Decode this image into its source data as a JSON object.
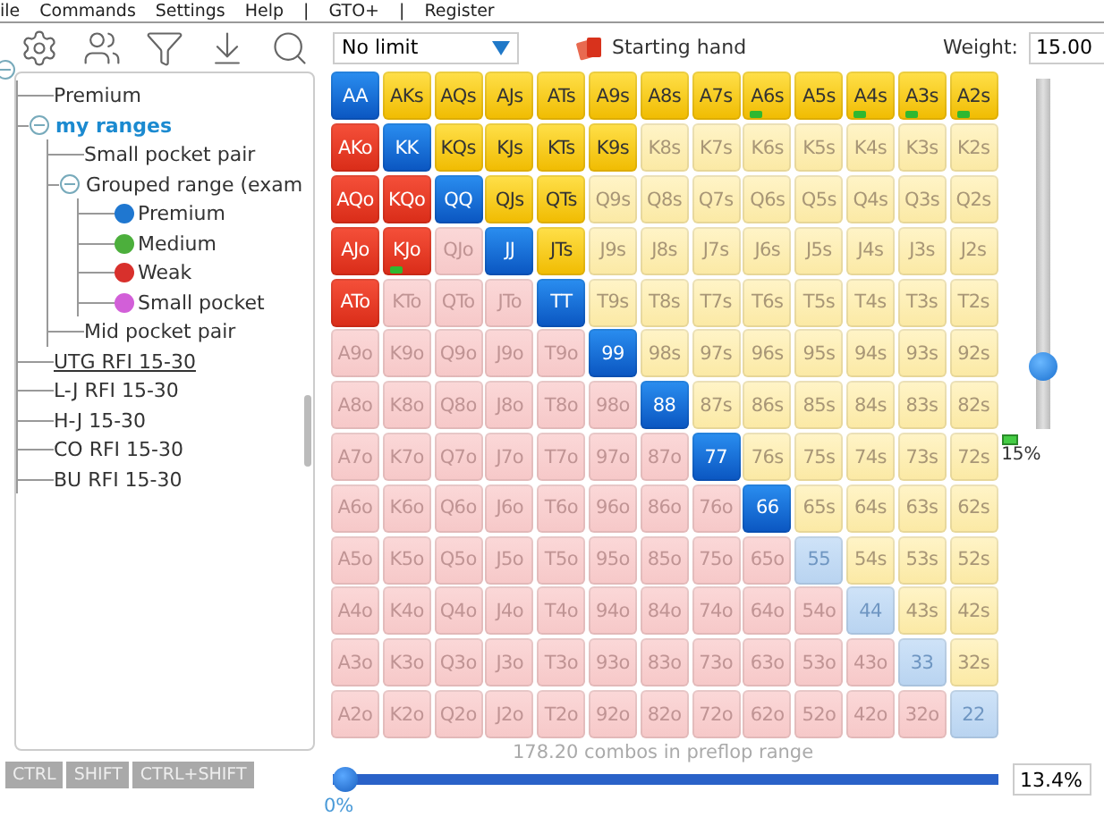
{
  "menu": [
    "ile",
    "Commands",
    "Settings",
    "Help",
    "|",
    "GTO+",
    "|",
    "Register"
  ],
  "tree": {
    "expanded": true,
    "children": [
      {
        "label": "Premium",
        "hovered": false
      },
      {
        "label": "my ranges",
        "hovered": false,
        "expanded": true,
        "children": [
          {
            "label": "Small pocket pair",
            "hovered": false
          },
          {
            "label": "Grouped range (exam",
            "hovered": false,
            "expanded": true,
            "children": [
              {
                "label": "Premium",
                "hovered": false,
                "color": "#1f77d0"
              },
              {
                "label": "Medium",
                "hovered": false,
                "color": "#4caf3c"
              },
              {
                "label": "Weak",
                "hovered": false,
                "color": "#d8302c"
              },
              {
                "label": "Small pocket",
                "hovered": false,
                "color": "#d25fd8"
              }
            ]
          },
          {
            "label": "Mid pocket pair",
            "hovered": false
          }
        ]
      },
      {
        "label": "UTG RFI 15-30",
        "hovered": true
      },
      {
        "label": "L-J RFI 15-30",
        "hovered": false
      },
      {
        "label": "H-J 15-30",
        "hovered": false
      },
      {
        "label": "CO RFI 15-30",
        "hovered": false
      },
      {
        "label": "BU RFI 15-30",
        "hovered": false
      }
    ]
  },
  "modifier_buttons": [
    "CTRL",
    "SHIFT",
    "CTRL+SHIFT"
  ],
  "game_select": {
    "value": "No limit"
  },
  "starting_hand": {
    "label": "Starting hand"
  },
  "weight": {
    "label": "Weight:",
    "value": "15.00"
  },
  "grid": [
    [
      {
        "label": "AA",
        "kind": "pair",
        "selected": true,
        "marked": false
      },
      {
        "label": "AKs",
        "kind": "suited",
        "selected": true,
        "marked": false
      },
      {
        "label": "AQs",
        "kind": "suited",
        "selected": true,
        "marked": false
      },
      {
        "label": "AJs",
        "kind": "suited",
        "selected": true,
        "marked": false
      },
      {
        "label": "ATs",
        "kind": "suited",
        "selected": true,
        "marked": false
      },
      {
        "label": "A9s",
        "kind": "suited",
        "selected": true,
        "marked": false
      },
      {
        "label": "A8s",
        "kind": "suited",
        "selected": true,
        "marked": false
      },
      {
        "label": "A7s",
        "kind": "suited",
        "selected": true,
        "marked": false
      },
      {
        "label": "A6s",
        "kind": "suited",
        "selected": true,
        "marked": true
      },
      {
        "label": "A5s",
        "kind": "suited",
        "selected": true,
        "marked": false
      },
      {
        "label": "A4s",
        "kind": "suited",
        "selected": true,
        "marked": true
      },
      {
        "label": "A3s",
        "kind": "suited",
        "selected": true,
        "marked": true
      },
      {
        "label": "A2s",
        "kind": "suited",
        "selected": true,
        "marked": true
      }
    ],
    [
      {
        "label": "AKo",
        "kind": "offsuit",
        "selected": true,
        "marked": false
      },
      {
        "label": "KK",
        "kind": "pair",
        "selected": true,
        "marked": false
      },
      {
        "label": "KQs",
        "kind": "suited",
        "selected": true,
        "marked": false
      },
      {
        "label": "KJs",
        "kind": "suited",
        "selected": true,
        "marked": false
      },
      {
        "label": "KTs",
        "kind": "suited",
        "selected": true,
        "marked": false
      },
      {
        "label": "K9s",
        "kind": "suited",
        "selected": true,
        "marked": false
      },
      {
        "label": "K8s",
        "kind": "suited",
        "selected": false,
        "marked": false
      },
      {
        "label": "K7s",
        "kind": "suited",
        "selected": false,
        "marked": false
      },
      {
        "label": "K6s",
        "kind": "suited",
        "selected": false,
        "marked": false
      },
      {
        "label": "K5s",
        "kind": "suited",
        "selected": false,
        "marked": false
      },
      {
        "label": "K4s",
        "kind": "suited",
        "selected": false,
        "marked": false
      },
      {
        "label": "K3s",
        "kind": "suited",
        "selected": false,
        "marked": false
      },
      {
        "label": "K2s",
        "kind": "suited",
        "selected": false,
        "marked": false
      }
    ],
    [
      {
        "label": "AQo",
        "kind": "offsuit",
        "selected": true,
        "marked": false
      },
      {
        "label": "KQo",
        "kind": "offsuit",
        "selected": true,
        "marked": false
      },
      {
        "label": "QQ",
        "kind": "pair",
        "selected": true,
        "marked": false
      },
      {
        "label": "QJs",
        "kind": "suited",
        "selected": true,
        "marked": false
      },
      {
        "label": "QTs",
        "kind": "suited",
        "selected": true,
        "marked": false
      },
      {
        "label": "Q9s",
        "kind": "suited",
        "selected": false,
        "marked": false
      },
      {
        "label": "Q8s",
        "kind": "suited",
        "selected": false,
        "marked": false
      },
      {
        "label": "Q7s",
        "kind": "suited",
        "selected": false,
        "marked": false
      },
      {
        "label": "Q6s",
        "kind": "suited",
        "selected": false,
        "marked": false
      },
      {
        "label": "Q5s",
        "kind": "suited",
        "selected": false,
        "marked": false
      },
      {
        "label": "Q4s",
        "kind": "suited",
        "selected": false,
        "marked": false
      },
      {
        "label": "Q3s",
        "kind": "suited",
        "selected": false,
        "marked": false
      },
      {
        "label": "Q2s",
        "kind": "suited",
        "selected": false,
        "marked": false
      }
    ],
    [
      {
        "label": "AJo",
        "kind": "offsuit",
        "selected": true,
        "marked": false
      },
      {
        "label": "KJo",
        "kind": "offsuit",
        "selected": true,
        "marked": true
      },
      {
        "label": "QJo",
        "kind": "offsuit",
        "selected": false,
        "marked": false
      },
      {
        "label": "JJ",
        "kind": "pair",
        "selected": true,
        "marked": false
      },
      {
        "label": "JTs",
        "kind": "suited",
        "selected": true,
        "marked": false
      },
      {
        "label": "J9s",
        "kind": "suited",
        "selected": false,
        "marked": false
      },
      {
        "label": "J8s",
        "kind": "suited",
        "selected": false,
        "marked": false
      },
      {
        "label": "J7s",
        "kind": "suited",
        "selected": false,
        "marked": false
      },
      {
        "label": "J6s",
        "kind": "suited",
        "selected": false,
        "marked": false
      },
      {
        "label": "J5s",
        "kind": "suited",
        "selected": false,
        "marked": false
      },
      {
        "label": "J4s",
        "kind": "suited",
        "selected": false,
        "marked": false
      },
      {
        "label": "J3s",
        "kind": "suited",
        "selected": false,
        "marked": false
      },
      {
        "label": "J2s",
        "kind": "suited",
        "selected": false,
        "marked": false
      }
    ],
    [
      {
        "label": "ATo",
        "kind": "offsuit",
        "selected": true,
        "marked": false
      },
      {
        "label": "KTo",
        "kind": "offsuit",
        "selected": false,
        "marked": false
      },
      {
        "label": "QTo",
        "kind": "offsuit",
        "selected": false,
        "marked": false
      },
      {
        "label": "JTo",
        "kind": "offsuit",
        "selected": false,
        "marked": false
      },
      {
        "label": "TT",
        "kind": "pair",
        "selected": true,
        "marked": false
      },
      {
        "label": "T9s",
        "kind": "suited",
        "selected": false,
        "marked": false
      },
      {
        "label": "T8s",
        "kind": "suited",
        "selected": false,
        "marked": false
      },
      {
        "label": "T7s",
        "kind": "suited",
        "selected": false,
        "marked": false
      },
      {
        "label": "T6s",
        "kind": "suited",
        "selected": false,
        "marked": false
      },
      {
        "label": "T5s",
        "kind": "suited",
        "selected": false,
        "marked": false
      },
      {
        "label": "T4s",
        "kind": "suited",
        "selected": false,
        "marked": false
      },
      {
        "label": "T3s",
        "kind": "suited",
        "selected": false,
        "marked": false
      },
      {
        "label": "T2s",
        "kind": "suited",
        "selected": false,
        "marked": false
      }
    ],
    [
      {
        "label": "A9o",
        "kind": "offsuit",
        "selected": false,
        "marked": false
      },
      {
        "label": "K9o",
        "kind": "offsuit",
        "selected": false,
        "marked": false
      },
      {
        "label": "Q9o",
        "kind": "offsuit",
        "selected": false,
        "marked": false
      },
      {
        "label": "J9o",
        "kind": "offsuit",
        "selected": false,
        "marked": false
      },
      {
        "label": "T9o",
        "kind": "offsuit",
        "selected": false,
        "marked": false
      },
      {
        "label": "99",
        "kind": "pair",
        "selected": true,
        "marked": false
      },
      {
        "label": "98s",
        "kind": "suited",
        "selected": false,
        "marked": false
      },
      {
        "label": "97s",
        "kind": "suited",
        "selected": false,
        "marked": false
      },
      {
        "label": "96s",
        "kind": "suited",
        "selected": false,
        "marked": false
      },
      {
        "label": "95s",
        "kind": "suited",
        "selected": false,
        "marked": false
      },
      {
        "label": "94s",
        "kind": "suited",
        "selected": false,
        "marked": false
      },
      {
        "label": "93s",
        "kind": "suited",
        "selected": false,
        "marked": false
      },
      {
        "label": "92s",
        "kind": "suited",
        "selected": false,
        "marked": false
      }
    ],
    [
      {
        "label": "A8o",
        "kind": "offsuit",
        "selected": false,
        "marked": false
      },
      {
        "label": "K8o",
        "kind": "offsuit",
        "selected": false,
        "marked": false
      },
      {
        "label": "Q8o",
        "kind": "offsuit",
        "selected": false,
        "marked": false
      },
      {
        "label": "J8o",
        "kind": "offsuit",
        "selected": false,
        "marked": false
      },
      {
        "label": "T8o",
        "kind": "offsuit",
        "selected": false,
        "marked": false
      },
      {
        "label": "98o",
        "kind": "offsuit",
        "selected": false,
        "marked": false
      },
      {
        "label": "88",
        "kind": "pair",
        "selected": true,
        "marked": false
      },
      {
        "label": "87s",
        "kind": "suited",
        "selected": false,
        "marked": false
      },
      {
        "label": "86s",
        "kind": "suited",
        "selected": false,
        "marked": false
      },
      {
        "label": "85s",
        "kind": "suited",
        "selected": false,
        "marked": false
      },
      {
        "label": "84s",
        "kind": "suited",
        "selected": false,
        "marked": false
      },
      {
        "label": "83s",
        "kind": "suited",
        "selected": false,
        "marked": false
      },
      {
        "label": "82s",
        "kind": "suited",
        "selected": false,
        "marked": false
      }
    ],
    [
      {
        "label": "A7o",
        "kind": "offsuit",
        "selected": false,
        "marked": false
      },
      {
        "label": "K7o",
        "kind": "offsuit",
        "selected": false,
        "marked": false
      },
      {
        "label": "Q7o",
        "kind": "offsuit",
        "selected": false,
        "marked": false
      },
      {
        "label": "J7o",
        "kind": "offsuit",
        "selected": false,
        "marked": false
      },
      {
        "label": "T7o",
        "kind": "offsuit",
        "selected": false,
        "marked": false
      },
      {
        "label": "97o",
        "kind": "offsuit",
        "selected": false,
        "marked": false
      },
      {
        "label": "87o",
        "kind": "offsuit",
        "selected": false,
        "marked": false
      },
      {
        "label": "77",
        "kind": "pair",
        "selected": true,
        "marked": false
      },
      {
        "label": "76s",
        "kind": "suited",
        "selected": false,
        "marked": false
      },
      {
        "label": "75s",
        "kind": "suited",
        "selected": false,
        "marked": false
      },
      {
        "label": "74s",
        "kind": "suited",
        "selected": false,
        "marked": false
      },
      {
        "label": "73s",
        "kind": "suited",
        "selected": false,
        "marked": false
      },
      {
        "label": "72s",
        "kind": "suited",
        "selected": false,
        "marked": false
      }
    ],
    [
      {
        "label": "A6o",
        "kind": "offsuit",
        "selected": false,
        "marked": false
      },
      {
        "label": "K6o",
        "kind": "offsuit",
        "selected": false,
        "marked": false
      },
      {
        "label": "Q6o",
        "kind": "offsuit",
        "selected": false,
        "marked": false
      },
      {
        "label": "J6o",
        "kind": "offsuit",
        "selected": false,
        "marked": false
      },
      {
        "label": "T6o",
        "kind": "offsuit",
        "selected": false,
        "marked": false
      },
      {
        "label": "96o",
        "kind": "offsuit",
        "selected": false,
        "marked": false
      },
      {
        "label": "86o",
        "kind": "offsuit",
        "selected": false,
        "marked": false
      },
      {
        "label": "76o",
        "kind": "offsuit",
        "selected": false,
        "marked": false
      },
      {
        "label": "66",
        "kind": "pair",
        "selected": true,
        "marked": false
      },
      {
        "label": "65s",
        "kind": "suited",
        "selected": false,
        "marked": false
      },
      {
        "label": "64s",
        "kind": "suited",
        "selected": false,
        "marked": false
      },
      {
        "label": "63s",
        "kind": "suited",
        "selected": false,
        "marked": false
      },
      {
        "label": "62s",
        "kind": "suited",
        "selected": false,
        "marked": false
      }
    ],
    [
      {
        "label": "A5o",
        "kind": "offsuit",
        "selected": false,
        "marked": false
      },
      {
        "label": "K5o",
        "kind": "offsuit",
        "selected": false,
        "marked": false
      },
      {
        "label": "Q5o",
        "kind": "offsuit",
        "selected": false,
        "marked": false
      },
      {
        "label": "J5o",
        "kind": "offsuit",
        "selected": false,
        "marked": false
      },
      {
        "label": "T5o",
        "kind": "offsuit",
        "selected": false,
        "marked": false
      },
      {
        "label": "95o",
        "kind": "offsuit",
        "selected": false,
        "marked": false
      },
      {
        "label": "85o",
        "kind": "offsuit",
        "selected": false,
        "marked": false
      },
      {
        "label": "75o",
        "kind": "offsuit",
        "selected": false,
        "marked": false
      },
      {
        "label": "65o",
        "kind": "offsuit",
        "selected": false,
        "marked": false
      },
      {
        "label": "55",
        "kind": "pair",
        "selected": false,
        "marked": false
      },
      {
        "label": "54s",
        "kind": "suited",
        "selected": false,
        "marked": false
      },
      {
        "label": "53s",
        "kind": "suited",
        "selected": false,
        "marked": false
      },
      {
        "label": "52s",
        "kind": "suited",
        "selected": false,
        "marked": false
      }
    ],
    [
      {
        "label": "A4o",
        "kind": "offsuit",
        "selected": false,
        "marked": false
      },
      {
        "label": "K4o",
        "kind": "offsuit",
        "selected": false,
        "marked": false
      },
      {
        "label": "Q4o",
        "kind": "offsuit",
        "selected": false,
        "marked": false
      },
      {
        "label": "J4o",
        "kind": "offsuit",
        "selected": false,
        "marked": false
      },
      {
        "label": "T4o",
        "kind": "offsuit",
        "selected": false,
        "marked": false
      },
      {
        "label": "94o",
        "kind": "offsuit",
        "selected": false,
        "marked": false
      },
      {
        "label": "84o",
        "kind": "offsuit",
        "selected": false,
        "marked": false
      },
      {
        "label": "74o",
        "kind": "offsuit",
        "selected": false,
        "marked": false
      },
      {
        "label": "64o",
        "kind": "offsuit",
        "selected": false,
        "marked": false
      },
      {
        "label": "54o",
        "kind": "offsuit",
        "selected": false,
        "marked": false
      },
      {
        "label": "44",
        "kind": "pair",
        "selected": false,
        "marked": false
      },
      {
        "label": "43s",
        "kind": "suited",
        "selected": false,
        "marked": false
      },
      {
        "label": "42s",
        "kind": "suited",
        "selected": false,
        "marked": false
      }
    ],
    [
      {
        "label": "A3o",
        "kind": "offsuit",
        "selected": false,
        "marked": false
      },
      {
        "label": "K3o",
        "kind": "offsuit",
        "selected": false,
        "marked": false
      },
      {
        "label": "Q3o",
        "kind": "offsuit",
        "selected": false,
        "marked": false
      },
      {
        "label": "J3o",
        "kind": "offsuit",
        "selected": false,
        "marked": false
      },
      {
        "label": "T3o",
        "kind": "offsuit",
        "selected": false,
        "marked": false
      },
      {
        "label": "93o",
        "kind": "offsuit",
        "selected": false,
        "marked": false
      },
      {
        "label": "83o",
        "kind": "offsuit",
        "selected": false,
        "marked": false
      },
      {
        "label": "73o",
        "kind": "offsuit",
        "selected": false,
        "marked": false
      },
      {
        "label": "63o",
        "kind": "offsuit",
        "selected": false,
        "marked": false
      },
      {
        "label": "53o",
        "kind": "offsuit",
        "selected": false,
        "marked": false
      },
      {
        "label": "43o",
        "kind": "offsuit",
        "selected": false,
        "marked": false
      },
      {
        "label": "33",
        "kind": "pair",
        "selected": false,
        "marked": false
      },
      {
        "label": "32s",
        "kind": "suited",
        "selected": false,
        "marked": false
      }
    ],
    [
      {
        "label": "A2o",
        "kind": "offsuit",
        "selected": false,
        "marked": false
      },
      {
        "label": "K2o",
        "kind": "offsuit",
        "selected": false,
        "marked": false
      },
      {
        "label": "Q2o",
        "kind": "offsuit",
        "selected": false,
        "marked": false
      },
      {
        "label": "J2o",
        "kind": "offsuit",
        "selected": false,
        "marked": false
      },
      {
        "label": "T2o",
        "kind": "offsuit",
        "selected": false,
        "marked": false
      },
      {
        "label": "92o",
        "kind": "offsuit",
        "selected": false,
        "marked": false
      },
      {
        "label": "82o",
        "kind": "offsuit",
        "selected": false,
        "marked": false
      },
      {
        "label": "72o",
        "kind": "offsuit",
        "selected": false,
        "marked": false
      },
      {
        "label": "62o",
        "kind": "offsuit",
        "selected": false,
        "marked": false
      },
      {
        "label": "52o",
        "kind": "offsuit",
        "selected": false,
        "marked": false
      },
      {
        "label": "42o",
        "kind": "offsuit",
        "selected": false,
        "marked": false
      },
      {
        "label": "32o",
        "kind": "offsuit",
        "selected": false,
        "marked": false
      },
      {
        "label": "22",
        "kind": "pair",
        "selected": false,
        "marked": false
      }
    ]
  ],
  "weight_slider": {
    "level": 0.15,
    "marked": true,
    "reading": "15%"
  },
  "combos": "178.20 combos in preflop range",
  "range_slider": {
    "level": 0,
    "min_label": "0%",
    "value": "13.4%"
  }
}
